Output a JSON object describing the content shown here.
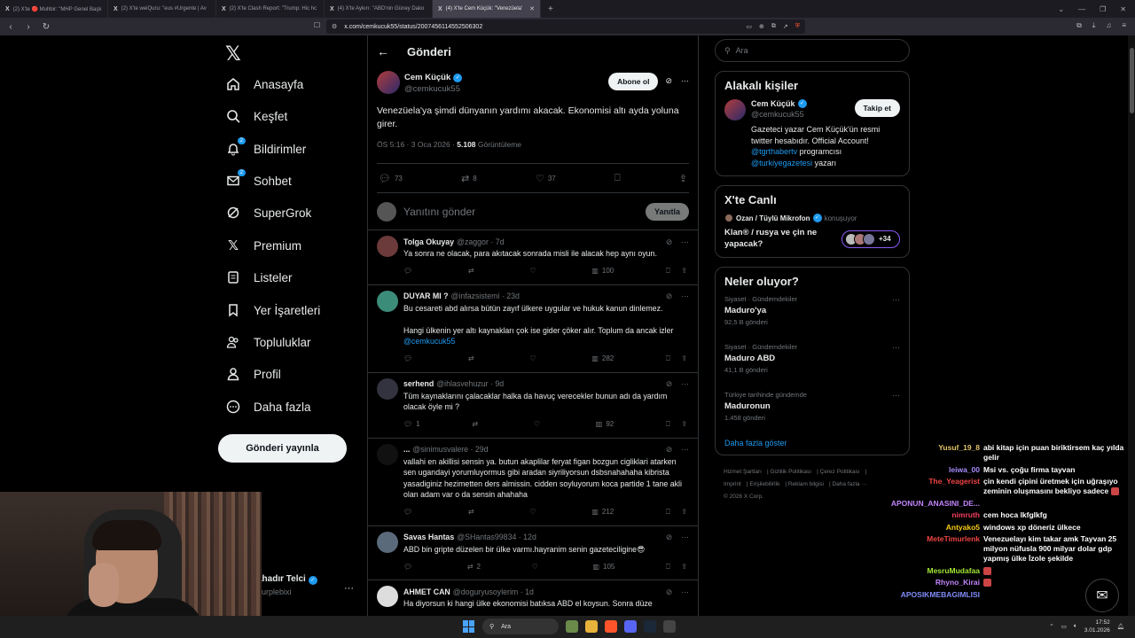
{
  "browser": {
    "tabs": [
      {
        "title": "(2) X'te 🔴 Muhbir: \"MHP Genel Başk",
        "active": false
      },
      {
        "title": "(2) X'te weiQuru: \"eus #Urgente | Av",
        "active": false
      },
      {
        "title": "(2) X'te Clash Report: \"Trump: Hic hc",
        "active": false
      },
      {
        "title": "(4) X'te Aykırı: \"ABD'nin Güney Dako",
        "active": false
      },
      {
        "title": "(4) X'te Cem Küçük: \"Venezüela'",
        "active": true
      }
    ],
    "url": "x.com/cemkucuk55/status/2007456114552506302"
  },
  "nav": {
    "items": [
      {
        "label": "Anasayfa",
        "icon": "home-icon"
      },
      {
        "label": "Keşfet",
        "icon": "search-icon"
      },
      {
        "label": "Bildirimler",
        "icon": "bell-icon",
        "badge": "2"
      },
      {
        "label": "Sohbet",
        "icon": "mail-icon",
        "badge": "2"
      },
      {
        "label": "SuperGrok",
        "icon": "grok-icon"
      },
      {
        "label": "Premium",
        "icon": "x-premium-icon"
      },
      {
        "label": "Listeler",
        "icon": "list-icon"
      },
      {
        "label": "Yer İşaretleri",
        "icon": "bookmark-icon"
      },
      {
        "label": "Topluluklar",
        "icon": "communities-icon"
      },
      {
        "label": "Profil",
        "icon": "profile-icon"
      },
      {
        "label": "Daha fazla",
        "icon": "more-circle-icon"
      }
    ],
    "post_button": "Gönderi yayınla",
    "account_name": "ahadır Telci",
    "account_handle": "purplebixi"
  },
  "main": {
    "header_title": "Gönderi",
    "post": {
      "author_name": "Cem Küçük",
      "author_handle": "@cemkucuk55",
      "subscribe_label": "Abone ol",
      "text": "Venezüela'ya şimdi dünyanın yardımı akacak. Ekonomisi altı ayda yoluna girer.",
      "time": "ÖS 5:16 · 3 Oca 2026 · ",
      "views_count": "5.108",
      "views_label": " Görüntüleme",
      "replies": "73",
      "reposts": "8",
      "likes": "37"
    },
    "reply_placeholder": "Yanıtını gönder",
    "reply_button": "Yanıtla",
    "replies": [
      {
        "name": "Tolga Okuyay",
        "meta": "@zaggor · 7d",
        "text": "Ya sonra ne olacak, para akıtacak sonrada misli ile alacak hep aynı oyun.",
        "replies": "",
        "reposts": "",
        "likes": "",
        "views": "100",
        "avatar": "#6b3a3a"
      },
      {
        "name": "DUYAR MI ?",
        "meta": "@infazsistemi · 23d",
        "text": "Bu cesareti abd alırsa bütün zayıf ülkere uygular ve hukuk kanun dinlemez.",
        "text2": "Hangi ülkenin yer altı kaynakları çok ise gider çöker alır. Toplum da ancak izler ",
        "mention": "@cemkucuk55",
        "replies": "",
        "reposts": "",
        "likes": "",
        "views": "282",
        "avatar": "#3c8c7a"
      },
      {
        "name": "serhend",
        "meta": "@ihlasvehuzur · 9d",
        "text": "Tüm kaynaklarını çalacaklar halka da havuç verecekler bunun adı da yardım olacak öyle mi ?",
        "replies": "1",
        "reposts": "",
        "likes": "",
        "views": "92",
        "avatar": "#333340"
      },
      {
        "name": "...",
        "meta": "@sinimusvalere · 29d",
        "text": "vallahi en akillisi sensin ya. butun akaplilar feryat figan bozgun cigliklari atarken sen ugandayi yorumluyormus gibi aradan siyriliyorsun dsbsnahahaha kibrista yasadiginiz hezimetten ders almissin. cidden soyluyorum koca partide 1 tane akli olan adam var o da sensin ahahaha",
        "replies": "",
        "reposts": "",
        "likes": "",
        "views": "212",
        "avatar": "#111111"
      },
      {
        "name": "Savas Hantas",
        "meta": "@SHantas99834 · 12d",
        "text": "ABD bin gripte düzelen bir ülke varmı.hayranim senin gazeteciligine😎",
        "replies": "",
        "reposts": "2",
        "likes": "",
        "views": "105",
        "avatar": "#5a6a7a"
      },
      {
        "name": "AHMET CAN",
        "meta": "@doguryusoylerim · 1d",
        "text": "Ha diyorsun ki hangi ülke ekonomisi batıksa ABD el koysun. Sonra düze",
        "replies": "",
        "reposts": "",
        "likes": "",
        "views": "",
        "avatar": "#dddddd"
      }
    ]
  },
  "right": {
    "search_placeholder": "Ara",
    "related_title": "Alakalı kişiler",
    "related": {
      "name": "Cem Küçük",
      "handle": "@cemkucuk55",
      "follow": "Takip et",
      "bio1": "Gazeteci yazar Cem Küçük'ün resmi twitter hesabıdır. Official Account!",
      "mention1": "@tgrthabertv",
      "bio2": " programcısı",
      "mention2": "@turkiyegazetesi",
      "bio3": " yazarı"
    },
    "live_title": "X'te Canlı",
    "live": {
      "host": "Ozan / Tüylü Mikrofon",
      "status": "konuşuyor",
      "title": "Klan® / rusya ve çin ne yapacak?",
      "count": "+34"
    },
    "trends_title": "Neler oluyor?",
    "trends": [
      {
        "cat": "Siyaset · Gündemdekiler",
        "name": "Maduro'ya",
        "count": "92,5 B gönderi"
      },
      {
        "cat": "Siyaset · Gündemdekiler",
        "name": "Maduro ABD",
        "count": "41,1 B gönderi"
      },
      {
        "cat": "Türkiye tarihinde gündemde",
        "name": "Maduronun",
        "count": "1.458 gönderi"
      }
    ],
    "show_more": "Daha fazla göster",
    "footer": [
      "Hizmet Şartları",
      "Gizlilik Politikası",
      "Çerez Politikası",
      "Imprint",
      "Erişilebilirlik",
      "Reklam bilgisi",
      "Daha fazla ···",
      "© 2026 X Corp."
    ]
  },
  "chat": [
    {
      "user": "Yusuf_19_8",
      "color": "#e0c36a",
      "msg": "abi kitap için puan biriktirsem kaç yılda gelir"
    },
    {
      "user": "leiwa_00",
      "color": "#a78bfa",
      "msg": "Msi vs. çoğu firma tayvan"
    },
    {
      "user": "The_Yeagerist",
      "color": "#ef4444",
      "msg": "çin kendi çipini üretmek için uğraşıyo zeminin oluşmasını bekliyo sadece",
      "emote": true
    },
    {
      "user": "APONUN_ANASINI_DE...",
      "color": "#c084fc",
      "msg": ""
    },
    {
      "user": "nimruth",
      "color": "#f43f5e",
      "msg": "cem hoca lkfglkfg"
    },
    {
      "user": "Antyako5",
      "color": "#facc15",
      "msg": "windows xp döneriz ülkece"
    },
    {
      "user": "MeteTimurlenk",
      "color": "#ef4444",
      "msg": "Venezuelayı kim takar amk Tayvan 25 milyon nüfusla 900 milyar dolar gdp yapmış ülke İzole şekilde"
    },
    {
      "user": "MesruMudafaa",
      "color": "#a3e635",
      "msg": "",
      "emote": true
    },
    {
      "user": "Rhyno_Kirai",
      "color": "#c084fc",
      "msg": "",
      "emote": true
    },
    {
      "user": "APOSIKMEBAGIMLISI",
      "color": "#818cf8",
      "msg": ""
    }
  ],
  "taskbar": {
    "search": "Ara",
    "time": "17:52",
    "date": "3.01.2026"
  }
}
